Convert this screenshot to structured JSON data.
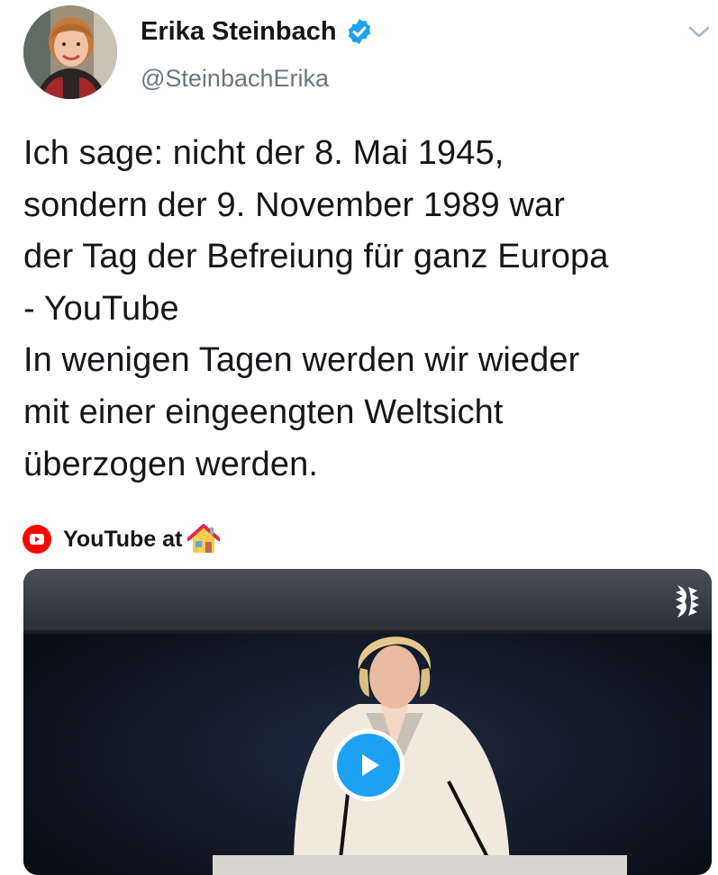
{
  "author": {
    "display_name": "Erika Steinbach",
    "handle": "@SteinbachErika",
    "verified": true
  },
  "tweet": {
    "lines": [
      "Ich sage: nicht der 8. Mai 1945,",
      "sondern der 9. November 1989 war",
      "der Tag der Befreiung für ganz Europa",
      "- YouTube",
      "In wenigen Tagen werden wir wieder",
      "mit einer eingeengten Weltsicht",
      "überzogen werden."
    ]
  },
  "card": {
    "source_label": "YouTube at",
    "source_icon": "youtube-icon",
    "emoji_icon": "house-icon"
  },
  "colors": {
    "verified_blue": "#1da1f2",
    "youtube_red": "#ff0000",
    "text_primary": "#14171a",
    "text_secondary": "#657786"
  }
}
